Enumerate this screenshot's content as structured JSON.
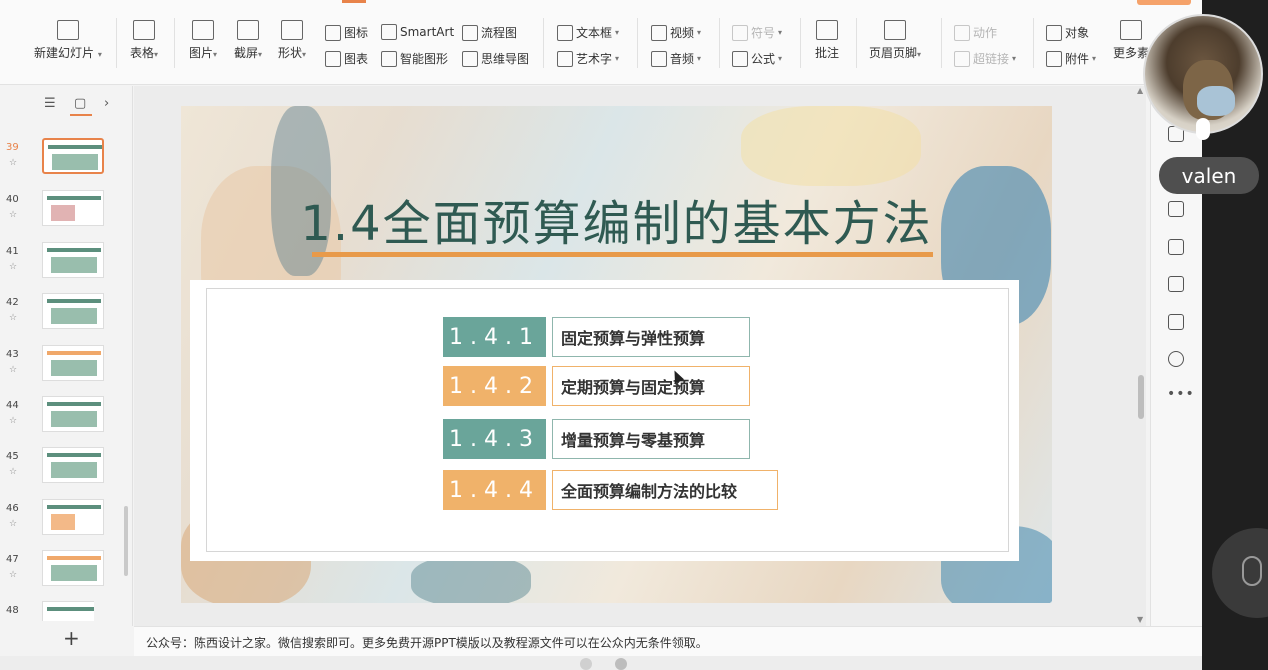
{
  "ribbon": {
    "new_slide": "新建幻灯片",
    "table": "表格",
    "picture": "图片",
    "screenshot": "截屏",
    "shape": "形状",
    "icon": "图标",
    "chart": "图表",
    "smartart": "SmartArt",
    "smart_shape": "智能图形",
    "flowchart": "流程图",
    "mindmap": "思维导图",
    "textbox": "文本框",
    "wordart": "艺术字",
    "video": "视频",
    "audio": "音频",
    "symbol": "符号",
    "formula": "公式",
    "comment": "批注",
    "header_footer": "页眉页脚",
    "action": "动作",
    "hyperlink": "超链接",
    "object": "对象",
    "attachment": "附件",
    "more": "更多素"
  },
  "slide_panel": {
    "slides": [
      {
        "num": "39",
        "star": "☆"
      },
      {
        "num": "40",
        "star": "☆"
      },
      {
        "num": "41",
        "star": "☆"
      },
      {
        "num": "42",
        "star": "☆"
      },
      {
        "num": "43",
        "star": "☆"
      },
      {
        "num": "44",
        "star": "☆"
      },
      {
        "num": "45",
        "star": "☆"
      },
      {
        "num": "46",
        "star": "☆"
      },
      {
        "num": "47",
        "star": "☆"
      },
      {
        "num": "48",
        "star": "☆"
      }
    ],
    "add": "+"
  },
  "slide": {
    "title": "1.4全面预算编制的基本方法",
    "items": [
      {
        "num": "1.4.1",
        "label": "固定预算与弹性预算",
        "color": "#6aa59a"
      },
      {
        "num": "1.4.2",
        "label": "定期预算与固定预算",
        "color": "#f0b26a"
      },
      {
        "num": "1.4.3",
        "label": "增量预算与零基预算",
        "color": "#6aa59a"
      },
      {
        "num": "1.4.4",
        "label": "全面预算编制方法的比较",
        "color": "#f0b26a"
      }
    ]
  },
  "notes": "公众号：陈西设计之家。微信搜索即可。更多免费开源PPT模版以及教程源文件可以在公众内无条件领取。",
  "participant": {
    "name": "valen"
  }
}
